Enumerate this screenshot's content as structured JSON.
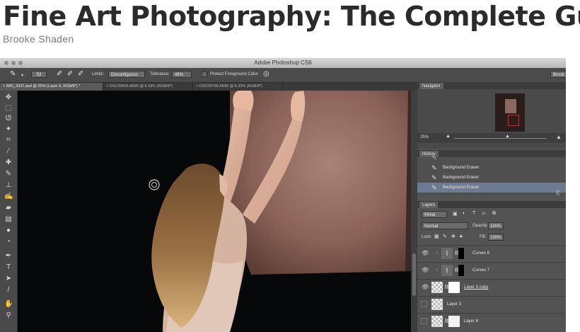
{
  "course": {
    "title": "Fine Art Photography: The Complete Gui",
    "author": "Brooke Shaden"
  },
  "app": {
    "window_title": "Adobe Photoshop CS6",
    "options_bar": {
      "brush_size": "53",
      "limits_label": "Limits:",
      "limits_value": "Discontiguous",
      "tolerance_label": "Tolerance:",
      "tolerance_value": "46%",
      "protect_label": "Protect Foreground Color",
      "workspace_label": "Brook"
    },
    "doc_tabs": [
      {
        "label": "IMG_6337.psd @ 25% (Layer 9, RGB/8*) *",
        "active": true
      },
      {
        "label": "DSC09825.ARW @ 8.33% (RGB/8*)",
        "active": false
      },
      {
        "label": "DSC09768.ARW @ 8.33% (RGB/8*)",
        "active": false
      }
    ],
    "navigator": {
      "tab": "Navigator",
      "zoom": "25%"
    },
    "history": {
      "tab": "History",
      "items": [
        {
          "label": "Background Eraser",
          "selected": false
        },
        {
          "label": "Background Eraser",
          "selected": false
        },
        {
          "label": "Background Eraser",
          "selected": true
        }
      ]
    },
    "layers": {
      "tab": "Layers",
      "kind_label": "Kind",
      "blend_mode": "Normal",
      "opacity_label": "Opacity:",
      "opacity_value": "100%",
      "lock_label": "Lock:",
      "fill_label": "Fill:",
      "fill_value": "100%",
      "items": [
        {
          "name": "Curves 6",
          "visible": true,
          "type": "adjustment"
        },
        {
          "name": "Curves 7",
          "visible": true,
          "type": "adjustment"
        },
        {
          "name": "Layer 3 copy",
          "visible": true,
          "type": "masked"
        },
        {
          "name": "Layer 3",
          "visible": false,
          "type": "pixel"
        },
        {
          "name": "Layer 8",
          "visible": false,
          "type": "masked"
        }
      ]
    },
    "tool_icons": [
      "move-icon",
      "marquee-icon",
      "lasso-icon",
      "quick-select-icon",
      "crop-icon",
      "eyedropper-icon",
      "healing-brush-icon",
      "brush-icon",
      "stamp-icon",
      "history-brush-icon",
      "eraser-icon",
      "gradient-icon",
      "blur-icon",
      "dodge-icon",
      "pen-icon",
      "type-icon",
      "path-select-icon",
      "shape-icon",
      "hand-icon",
      "zoom-icon"
    ]
  }
}
